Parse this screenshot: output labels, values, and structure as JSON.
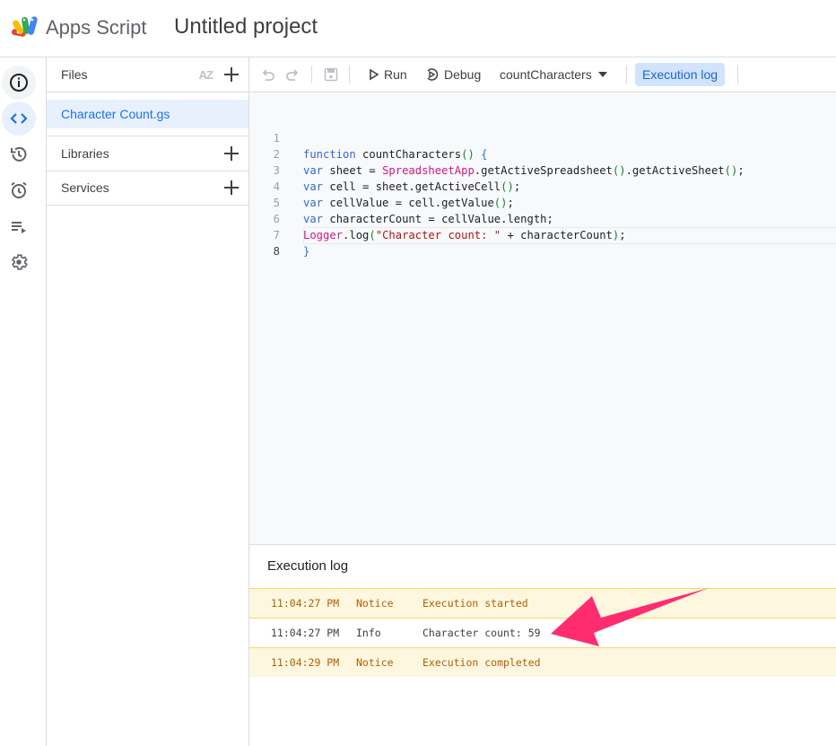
{
  "header": {
    "app_name": "Apps Script",
    "project_title": "Untitled project"
  },
  "rail": {
    "items": [
      {
        "name": "overview",
        "icon": "info-icon"
      },
      {
        "name": "editor",
        "icon": "code-icon",
        "active": true
      },
      {
        "name": "project-history",
        "icon": "history-icon"
      },
      {
        "name": "triggers",
        "icon": "alarm-icon"
      },
      {
        "name": "executions",
        "icon": "playlist-play-icon"
      },
      {
        "name": "settings",
        "icon": "gear-icon"
      }
    ]
  },
  "files_panel": {
    "files_label": "Files",
    "sort_label": "AZ",
    "files": [
      "Character Count.gs"
    ],
    "libraries_label": "Libraries",
    "services_label": "Services"
  },
  "toolbar": {
    "run_label": "Run",
    "debug_label": "Debug",
    "function_select": "countCharacters",
    "execution_log_label": "Execution log"
  },
  "editor": {
    "line_numbers": [
      "1",
      "2",
      "3",
      "4",
      "5",
      "6",
      "7",
      "8"
    ],
    "lines": [
      "function countCharacters() {",
      "var sheet = SpreadsheetApp.getActiveSpreadsheet().getActiveSheet();",
      "var cell = sheet.getActiveCell();",
      "var cellValue = cell.getValue();",
      "var characterCount = cellValue.length;",
      "Logger.log(\"Character count: \" + characterCount);",
      "}",
      ""
    ],
    "current_line": 8
  },
  "execution_log": {
    "title": "Execution log",
    "rows": [
      {
        "time": "11:04:27 PM",
        "level": "Notice",
        "message": "Execution started"
      },
      {
        "time": "11:04:27 PM",
        "level": "Info",
        "message": "Character count: 59"
      },
      {
        "time": "11:04:29 PM",
        "level": "Notice",
        "message": "Execution completed"
      }
    ]
  },
  "colors": {
    "accent": "#1a73e8",
    "active_bg": "#e8f0fe",
    "notice_bg": "#fef7e0",
    "notice_text": "#b06000",
    "annotation_arrow": "#ff2d6f"
  }
}
